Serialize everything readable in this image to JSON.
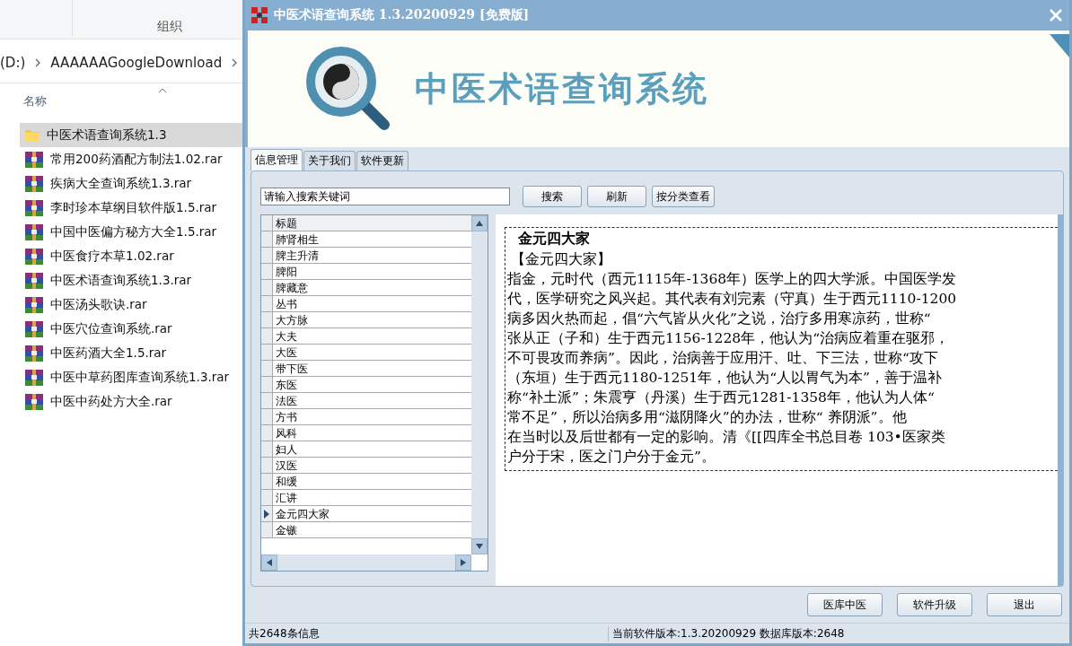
{
  "explorer": {
    "toolbar_label": "组织",
    "breadcrumb": [
      "(D:)",
      "AAAAAAGoogleDownload"
    ],
    "column_header": "名称",
    "files": [
      {
        "name": "中医术语查询系统1.3",
        "kind": "folder",
        "selected": true
      },
      {
        "name": "常用200药酒配方制法1.02.rar",
        "kind": "archive",
        "selected": false
      },
      {
        "name": "疾病大全查询系统1.3.rar",
        "kind": "archive",
        "selected": false
      },
      {
        "name": "李时珍本草纲目软件版1.5.rar",
        "kind": "archive",
        "selected": false
      },
      {
        "name": "中国中医偏方秘方大全1.5.rar",
        "kind": "archive",
        "selected": false
      },
      {
        "name": "中医食疗本草1.02.rar",
        "kind": "archive",
        "selected": false
      },
      {
        "name": "中医术语查询系统1.3.rar",
        "kind": "archive",
        "selected": false
      },
      {
        "name": "中医汤头歌诀.rar",
        "kind": "archive",
        "selected": false
      },
      {
        "name": "中医穴位查询系统.rar",
        "kind": "archive",
        "selected": false
      },
      {
        "name": "中医药酒大全1.5.rar",
        "kind": "archive",
        "selected": false
      },
      {
        "name": "中医中草药图库查询系统1.3.rar",
        "kind": "archive",
        "selected": false
      },
      {
        "name": "中医中药处方大全.rar",
        "kind": "archive",
        "selected": false
      }
    ]
  },
  "window": {
    "title": "中医术语查询系统 1.3.20200929 [免费版]",
    "banner_title": "中医术语查询系统"
  },
  "tabs": [
    {
      "label": "信息管理",
      "selected": true
    },
    {
      "label": "关于我们",
      "selected": false
    },
    {
      "label": "软件更新",
      "selected": false
    }
  ],
  "search": {
    "value": "请输入搜索关键词"
  },
  "search_buttons": [
    "搜索",
    "刷新",
    "按分类查看"
  ],
  "grid": {
    "column": "标题",
    "rows": [
      {
        "label": "肺肾相生",
        "selected": false
      },
      {
        "label": "脾主升清",
        "selected": false
      },
      {
        "label": "脾阳",
        "selected": false
      },
      {
        "label": "脾藏意",
        "selected": false
      },
      {
        "label": "丛书",
        "selected": false
      },
      {
        "label": "大方脉",
        "selected": false
      },
      {
        "label": "大夫",
        "selected": false
      },
      {
        "label": "大医",
        "selected": false
      },
      {
        "label": "带下医",
        "selected": false
      },
      {
        "label": "东医",
        "selected": false
      },
      {
        "label": "法医",
        "selected": false
      },
      {
        "label": "方书",
        "selected": false
      },
      {
        "label": "风科",
        "selected": false
      },
      {
        "label": "妇人",
        "selected": false
      },
      {
        "label": "汉医",
        "selected": false
      },
      {
        "label": "和缓",
        "selected": false
      },
      {
        "label": "汇讲",
        "selected": false
      },
      {
        "label": "金元四大家",
        "selected": true
      },
      {
        "label": "金镞",
        "selected": false
      }
    ]
  },
  "detail": {
    "heading": "金元四大家",
    "subheading": "【金元四大家】",
    "lines": [
      "指金，元时代（西元1115年-1368年）医学上的四大学派。中国医学发",
      "代，医学研究之风兴起。其代表有刘完素（守真）生于西元1110-1200",
      "病多因火热而起，倡“六气皆从火化”之说，治疗多用寒凉药，世称“",
      "张从正（子和）生于西元1156-1228年，他认为“治病应着重在驱邪，",
      "不可畏攻而养病”。因此，治病善于应用汗、吐、下三法，世称“攻下",
      "（东垣）生于西元1180-1251年，他认为“人以胃气为本”，善于温补",
      "称“补土派”；朱震亨（丹溪）生于西元1281-1358年，他认为人体“",
      "常不足”，所以治病多用“滋阴降火”的办法，世称“ 养阴派”。他",
      "在当时以及后世都有一定的影响。清《[[四库全书总目卷 103•医家类",
      "户分于宋，医之门户分于金元”。"
    ]
  },
  "footer_buttons": [
    "医库中医",
    "软件升级",
    "退出"
  ],
  "status_bar": {
    "left": "共2648条信息",
    "right": "当前软件版本:1.3.20200929 数据库版本:2648"
  }
}
